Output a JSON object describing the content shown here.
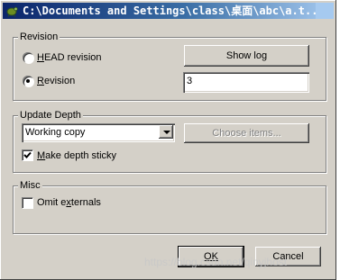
{
  "window": {
    "title": "C:\\Documents and Settings\\class\\桌面\\abc\\a.t..."
  },
  "revision": {
    "legend": "Revision",
    "head_option": {
      "label_pre": "",
      "label_u": "H",
      "label_post": "EAD revision",
      "selected": false
    },
    "rev_option": {
      "label_pre": "",
      "label_u": "R",
      "label_post": "evision",
      "selected": true
    },
    "show_log_label": "Show log",
    "rev_value": "3"
  },
  "depth": {
    "legend": "Update Depth",
    "selected": "Working copy",
    "choose_label": "Choose items...",
    "sticky": {
      "label_pre": "",
      "label_u": "M",
      "label_post": "ake depth sticky",
      "checked": true
    }
  },
  "misc": {
    "legend": "Misc",
    "omit": {
      "label_pre": "Omit e",
      "label_u": "x",
      "label_post": "ternals",
      "checked": false
    }
  },
  "buttons": {
    "ok_label": "OK",
    "cancel_label": "Cancel"
  },
  "watermark": "https://blog.csdn.net/qinyjhost"
}
